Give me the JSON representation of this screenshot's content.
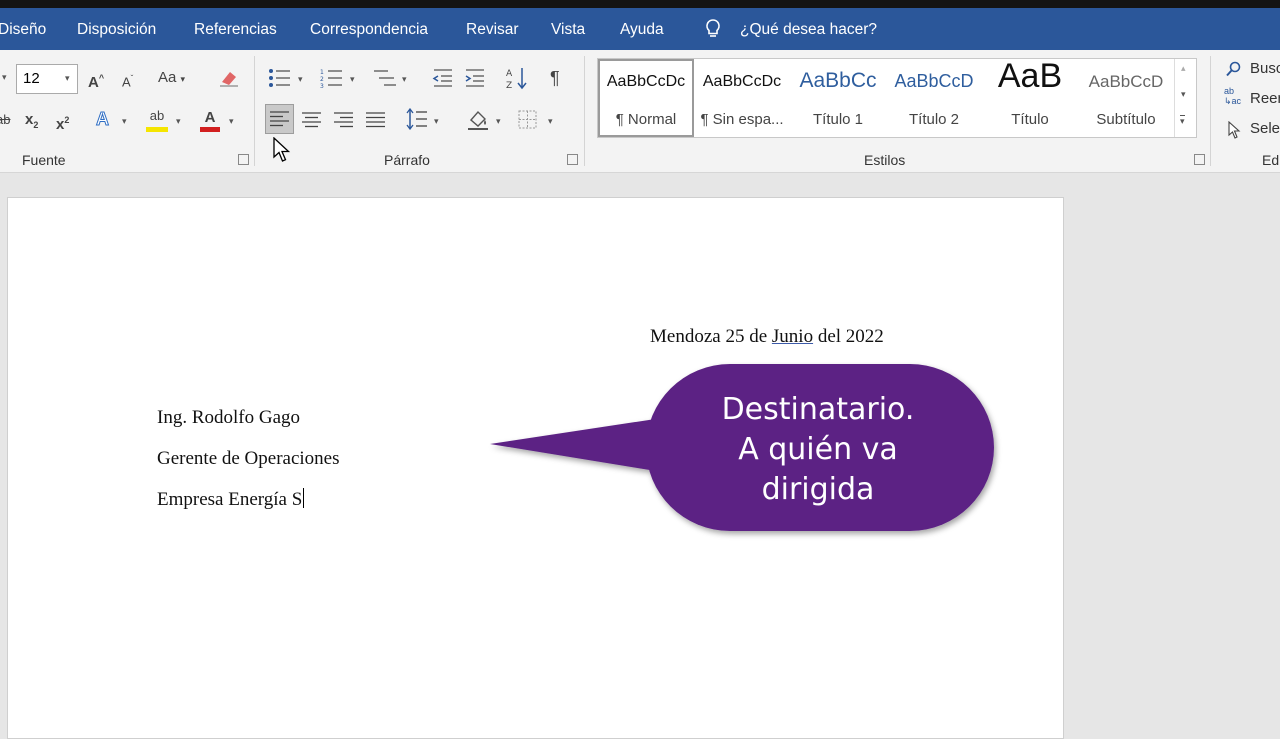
{
  "menu": {
    "tabs": [
      "Diseño",
      "Disposición",
      "Referencias",
      "Correspondencia",
      "Revisar",
      "Vista",
      "Ayuda"
    ],
    "tell_me": "¿Qué desea hacer?"
  },
  "font_group": {
    "size": "12",
    "grow": "A",
    "shrink": "A",
    "change_case": "Aa",
    "strike": "ab",
    "subscript": "x",
    "superscript": "x",
    "text_effects": "A",
    "highlight": "ab",
    "font_color": "A",
    "label": "Fuente"
  },
  "paragraph_group": {
    "label": "Párrafo"
  },
  "styles_group": {
    "label": "Estilos",
    "items": [
      {
        "preview": "AaBbCcDc",
        "name": "¶ Normal"
      },
      {
        "preview": "AaBbCcDc",
        "name": "¶ Sin espa..."
      },
      {
        "preview": "AaBbCc",
        "name": "Título 1"
      },
      {
        "preview": "AaBbCcD",
        "name": "Título 2"
      },
      {
        "preview": "AaB",
        "name": "Título"
      },
      {
        "preview": "AaBbCcD",
        "name": "Subtítulo"
      }
    ]
  },
  "editing_group": {
    "find": "Busc",
    "replace": "Reen",
    "select": "Selec",
    "label": "Ed"
  },
  "document": {
    "date_prefix": "Mendoza 25 de ",
    "date_month": "Junio",
    "date_suffix": " del 2022",
    "recipient_name": "Ing. Rodolfo Gago",
    "recipient_title": "Gerente de Operaciones",
    "recipient_company": "Empresa Energía S"
  },
  "callout": {
    "line1": "Destinatario.",
    "line2": "A quién va",
    "line3": "dirigida",
    "color": "#5c2384"
  },
  "colors": {
    "menubar": "#2b579a",
    "highlight": "#f5e500",
    "font_color": "#d21f1f"
  }
}
